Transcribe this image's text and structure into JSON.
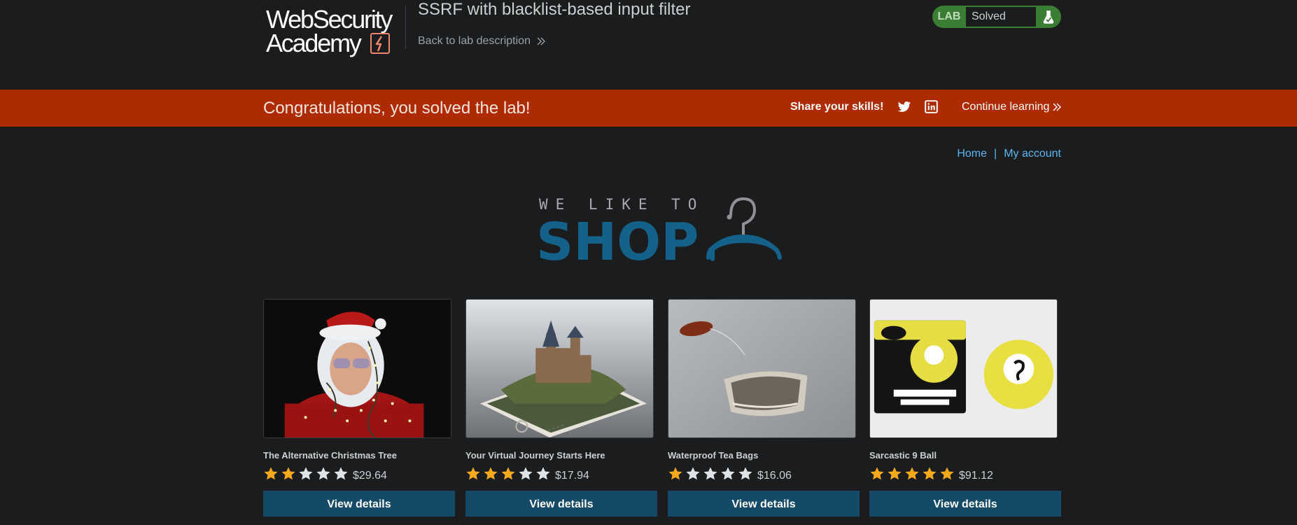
{
  "header": {
    "logo_line1": "WebSecurity",
    "logo_line2": "Academy",
    "lab_title": "SSRF with blacklist-based input filter",
    "back_link": "Back to lab description",
    "lab_badge": {
      "label": "LAB",
      "status": "Solved"
    }
  },
  "banner": {
    "message": "Congratulations, you solved the lab!",
    "share": "Share your skills!",
    "continue": "Continue learning"
  },
  "nav": {
    "home": "Home",
    "separator": "|",
    "account": "My account"
  },
  "shop_logo": {
    "tagline": "WE LIKE TO",
    "word": "SHOP"
  },
  "products": [
    {
      "name": "The Alternative Christmas Tree",
      "rating": 2,
      "max_rating": 5,
      "price": "$29.64",
      "button": "View details",
      "image": "man-with-lights-image"
    },
    {
      "name": "Your Virtual Journey Starts Here",
      "rating": 3,
      "max_rating": 5,
      "price": "$17.94",
      "button": "View details",
      "image": "castle-on-phone-image"
    },
    {
      "name": "Waterproof Tea Bags",
      "rating": 1,
      "max_rating": 5,
      "price": "$16.06",
      "button": "View details",
      "image": "tea-bag-image"
    },
    {
      "name": "Sarcastic 9 Ball",
      "rating": 5,
      "max_rating": 5,
      "price": "$91.12",
      "button": "View details",
      "image": "nine-ball-image"
    }
  ],
  "colors": {
    "background": "#1b1c1e",
    "banner": "#ae2b00",
    "lab_badge": "#3a7d33",
    "link": "#5ab7f0",
    "button": "#144a68",
    "star_filled": "#f7a91d",
    "star_empty": "#dfe4e6",
    "shop_blue": "#14618a"
  }
}
